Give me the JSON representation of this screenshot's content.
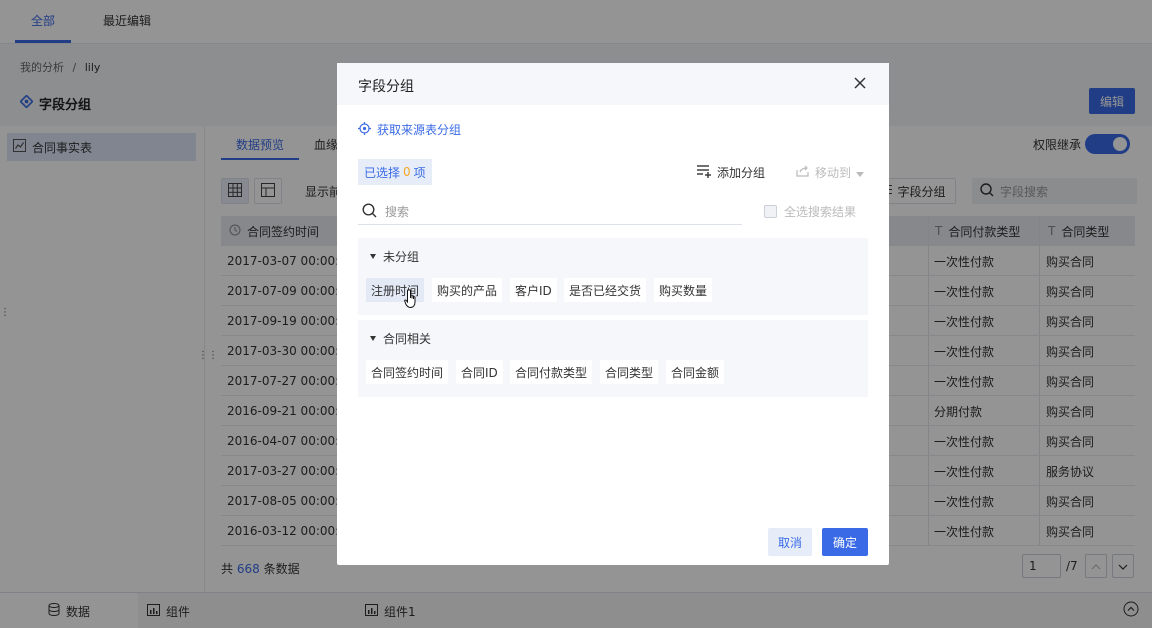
{
  "top_tabs": {
    "all": "全部",
    "recent": "最近编辑"
  },
  "breadcrumb": {
    "root": "我的分析",
    "sep": "/",
    "current": "lily"
  },
  "page": {
    "title": "字段分组",
    "edit_label": "编辑"
  },
  "left_panel": {
    "table_name": "合同事实表"
  },
  "main": {
    "tabs": {
      "preview": "数据预览",
      "lineage": "血缘"
    },
    "permission_label": "权限继承",
    "permission_on": true,
    "show_label": "显示前",
    "field_group_button": "字段分组",
    "field_search_placeholder": "字段搜索",
    "columns": {
      "sign_time": "合同签约时间",
      "pay_type": "合同付款类型",
      "contract_type": "合同类型"
    },
    "rows": [
      {
        "sign_time": "2017-03-07 00:00:00",
        "pay_type": "一次性付款",
        "contract_type": "购买合同"
      },
      {
        "sign_time": "2017-07-09 00:00:00",
        "pay_type": "一次性付款",
        "contract_type": "购买合同"
      },
      {
        "sign_time": "2017-09-19 00:00:00",
        "pay_type": "一次性付款",
        "contract_type": "购买合同"
      },
      {
        "sign_time": "2017-03-30 00:00:00",
        "pay_type": "一次性付款",
        "contract_type": "购买合同"
      },
      {
        "sign_time": "2017-07-27 00:00:00",
        "pay_type": "一次性付款",
        "contract_type": "购买合同"
      },
      {
        "sign_time": "2016-09-21 00:00:00",
        "pay_type": "分期付款",
        "contract_type": "购买合同"
      },
      {
        "sign_time": "2016-04-07 00:00:00",
        "pay_type": "一次性付款",
        "contract_type": "购买合同"
      },
      {
        "sign_time": "2017-03-27 00:00:00",
        "pay_type": "一次性付款",
        "contract_type": "服务协议"
      },
      {
        "sign_time": "2017-08-05 00:00:00",
        "pay_type": "一次性付款",
        "contract_type": "购买合同"
      },
      {
        "sign_time": "2016-03-12 00:00:00",
        "pay_type": "一次性付款",
        "contract_type": "购买合同"
      }
    ],
    "footer": {
      "prefix": "共",
      "count": "668",
      "suffix": "条数据"
    },
    "pager": {
      "current": "1",
      "total": "/7"
    }
  },
  "bottom_tabs": {
    "data": "数据",
    "component": "组件",
    "component1": "组件1"
  },
  "dialog": {
    "title": "字段分组",
    "fetch_source_label": "获取来源表分组",
    "selected_prefix": "已选择",
    "selected_count": "0",
    "selected_suffix": "项",
    "add_group_label": "添加分组",
    "move_to_label": "移动到",
    "search_placeholder": "搜索",
    "select_all_label": "全选搜索结果",
    "groups": [
      {
        "name": "未分组",
        "fields": [
          "注册时间",
          "购买的产品",
          "客户ID",
          "是否已经交货",
          "购买数量"
        ]
      },
      {
        "name": "合同相关",
        "fields": [
          "合同签约时间",
          "合同ID",
          "合同付款类型",
          "合同类型",
          "合同金额"
        ]
      }
    ],
    "cancel_label": "取消",
    "ok_label": "确定"
  },
  "colors": {
    "accent": "#3a6ae6",
    "highlight": "#f5a623"
  }
}
